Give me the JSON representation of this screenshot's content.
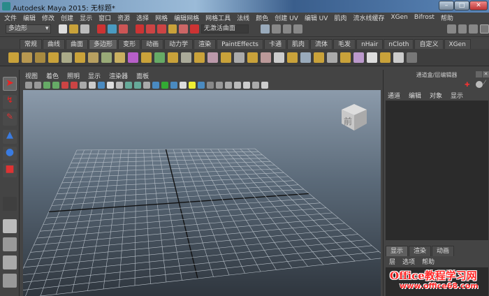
{
  "window": {
    "title": "Autodesk Maya 2015: 无标题*",
    "min": "–",
    "max": "□",
    "close": "✕"
  },
  "menu": [
    "文件",
    "编辑",
    "修改",
    "创建",
    "显示",
    "窗口",
    "资源",
    "选择",
    "网格",
    "编辑网格",
    "网格工具",
    "法线",
    "颜色",
    "创建 UV",
    "编辑 UV",
    "肌肉",
    "流水线缓存",
    "XGen",
    "Bifrost",
    "帮助"
  ],
  "status": {
    "menu_set": "多边形",
    "live_surface": "无激活曲面"
  },
  "shelf_tabs": [
    "常规",
    "曲线",
    "曲面",
    "多边形",
    "变形",
    "动画",
    "动力学",
    "渲染",
    "PaintEffects",
    "卡通",
    "肌肉",
    "流体",
    "毛发",
    "nHair",
    "nCloth",
    "自定义",
    "XGen"
  ],
  "active_shelf": "多边形",
  "viewport": {
    "menu": [
      "视图",
      "着色",
      "照明",
      "显示",
      "渲染器",
      "面板"
    ],
    "viewcube_label": "前"
  },
  "channel_box": {
    "title": "通道盒/层编辑器",
    "menu": [
      "通道",
      "编辑",
      "对象",
      "显示"
    ]
  },
  "layer_editor": {
    "tabs": [
      "显示",
      "渲染",
      "动画"
    ],
    "menu": [
      "层",
      "选项",
      "帮助"
    ]
  },
  "watermark": {
    "line1": "Office教程学习网",
    "line2": "www.office68.com"
  }
}
